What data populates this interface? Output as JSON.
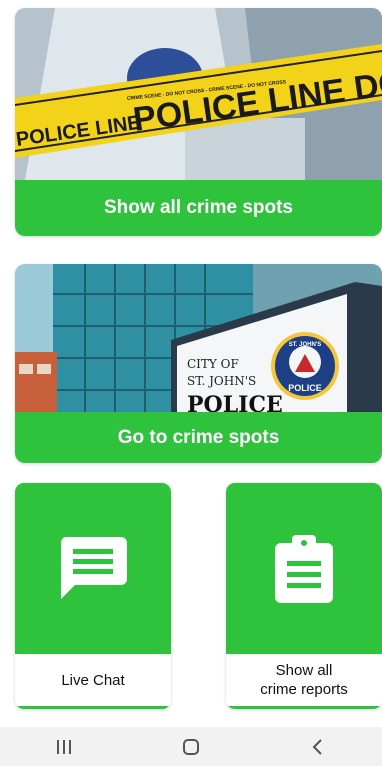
{
  "cards": [
    {
      "button_label": "Show all crime spots",
      "tape_text": "POLICE LINE DO NOT C",
      "tape_text_left": "POLICE LINE",
      "tape_small": "CRIME SCENE - DO NOT CROSS - CRIME SCENE - DO NOT CROSS"
    },
    {
      "button_label": "Go to crime spots",
      "sign_line1": "CITY OF",
      "sign_line2": "ST. JOHN'S",
      "sign_line3": "POLICE",
      "badge_text_top": "ST. JOHN'S",
      "badge_text": "POLICE"
    }
  ],
  "tiles": [
    {
      "label": "Live Chat",
      "icon": "chat-icon"
    },
    {
      "label": "Show all\ncrime reports",
      "icon": "clipboard-icon"
    }
  ],
  "navbar": {
    "icons": [
      "recent-apps-icon",
      "home-icon",
      "back-icon"
    ]
  },
  "colors": {
    "accent": "#2ec23d",
    "tape": "#f3d21a",
    "navbar": "#f2f2f2"
  }
}
